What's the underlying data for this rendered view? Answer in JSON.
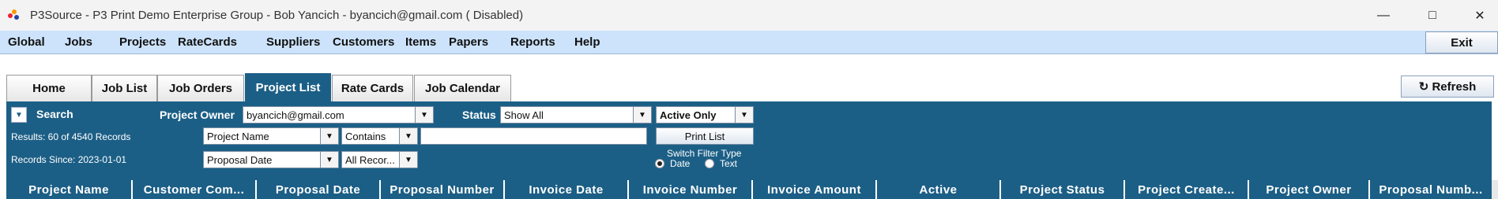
{
  "window": {
    "title": "P3Source - P3 Print Demo Enterprise Group - Bob Yancich - byancich@gmail.com ( Disabled)",
    "minimize_icon": "minimize-icon",
    "maximize_icon": "maximize-icon",
    "close_icon": "close-icon"
  },
  "menubar": {
    "items": [
      "Global",
      "Jobs",
      "Projects",
      "RateCards",
      "Suppliers",
      "Customers",
      "Items",
      "Papers",
      "Reports",
      "Help"
    ],
    "exit_label": "Exit"
  },
  "tabs": {
    "items": [
      "Home",
      "Job List",
      "Job Orders",
      "Project List",
      "Rate Cards",
      "Job Calendar"
    ],
    "active": "Project List",
    "refresh_label": "↻ Refresh"
  },
  "search": {
    "toggle_label": "Search",
    "owner_label": "Project Owner",
    "owner_value": "byancich@gmail.com",
    "status_label": "Status",
    "status_value": "Show All",
    "active_value": "Active Only",
    "results_text": "Results: 60 of 4540 Records",
    "field_value": "Project Name",
    "operator_value": "Contains",
    "search_text": "",
    "print_label": "Print List",
    "records_since_text": "Records Since: 2023-01-01",
    "date_field_value": "Proposal Date",
    "date_range_value": "All Recor...",
    "switch_filter_label": "Switch Filter Type",
    "radio_date_label": "Date",
    "radio_text_label": "Text",
    "selected_filter": "Date"
  },
  "table": {
    "columns": [
      "Project Name",
      "Customer Com...",
      "Proposal Date",
      "Proposal Number",
      "Invoice Date",
      "Invoice Number",
      "Invoice Amount",
      "Active",
      "Project Status",
      "Project Create...",
      "Project Owner",
      "Proposal Numb..."
    ]
  },
  "colors": {
    "accent": "#1c5f86",
    "menubar": "#cce3fb"
  }
}
